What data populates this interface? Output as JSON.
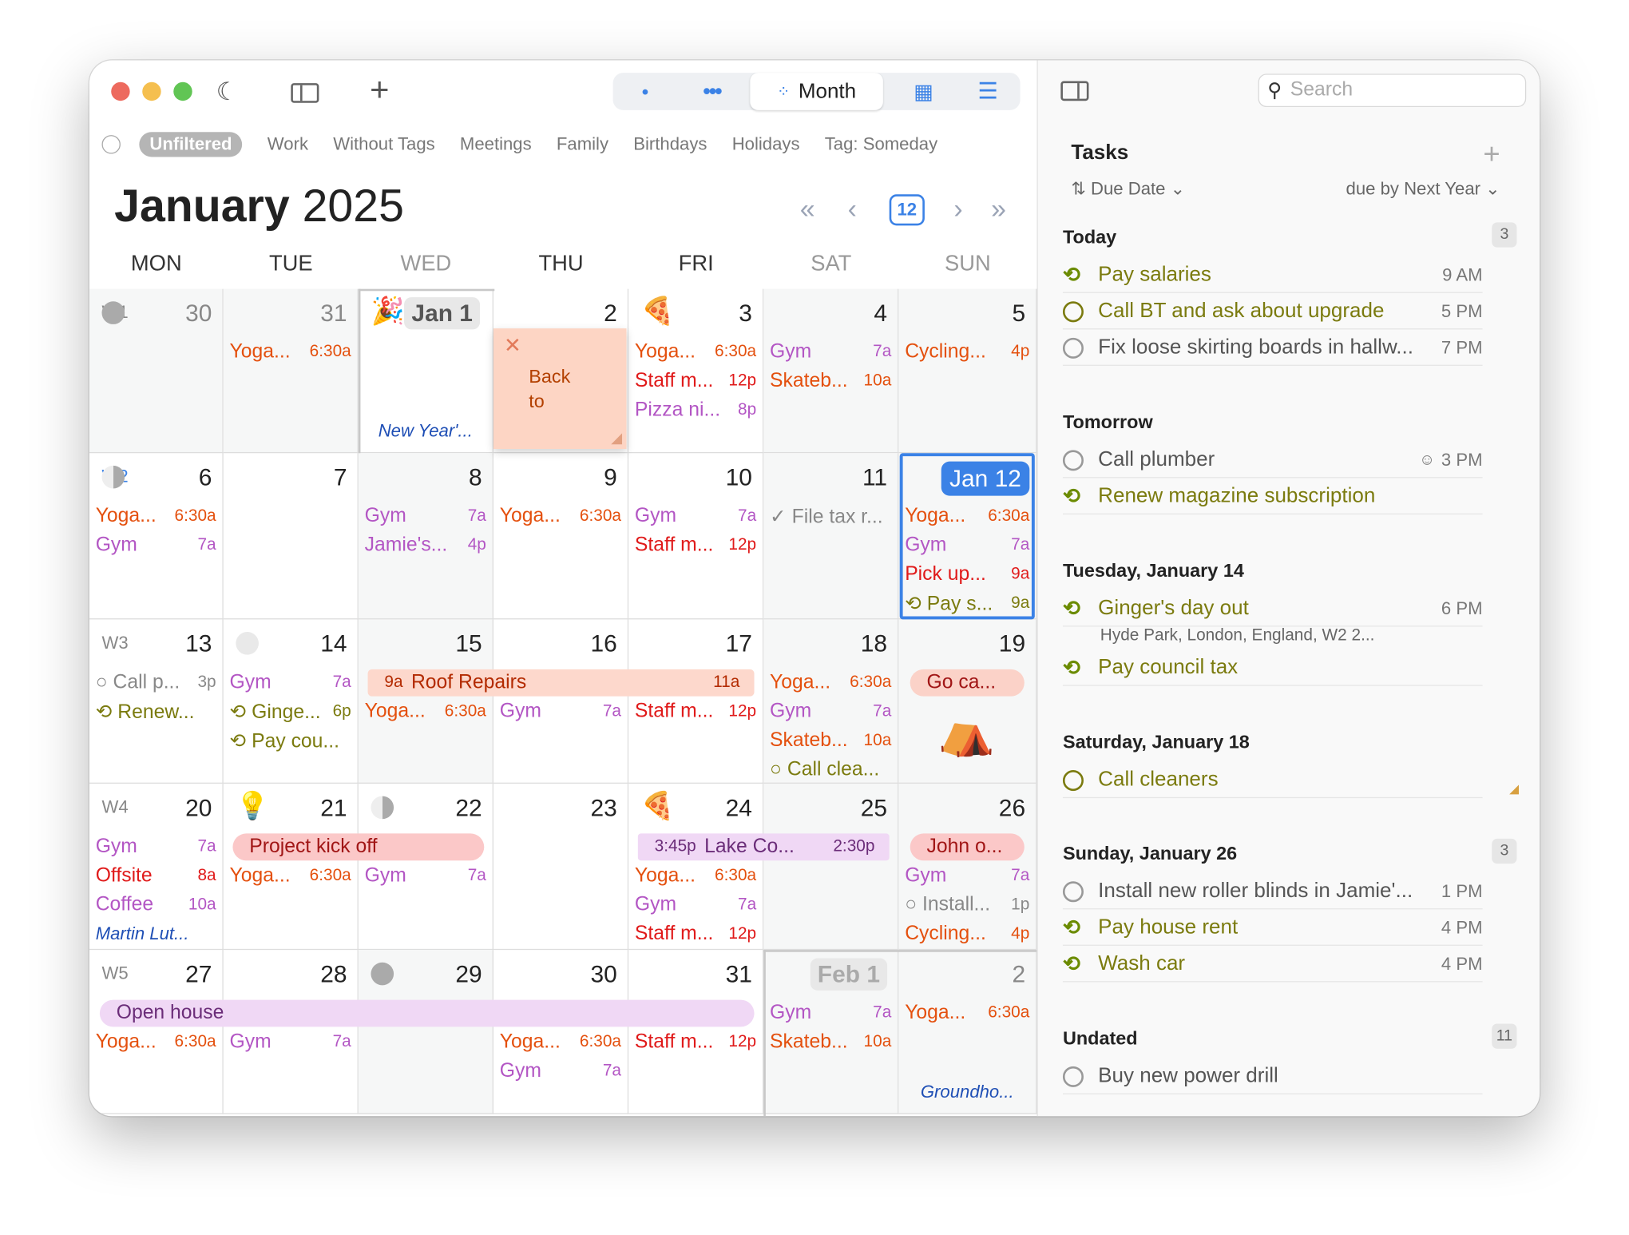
{
  "toolbar": {
    "segment_selected": "Month"
  },
  "filters": [
    "Unfiltered",
    "Work",
    "Without Tags",
    "Meetings",
    "Family",
    "Birthdays",
    "Holidays",
    "Tag: Someday"
  ],
  "calendar": {
    "month": "January",
    "year": "2025",
    "today_button": "12",
    "weekdays": [
      "MON",
      "TUE",
      "WED",
      "THU",
      "FRI",
      "SAT",
      "SUN"
    ],
    "weeks": [
      {
        "label": "W1",
        "days": [
          {
            "num": "30",
            "events": []
          },
          {
            "num": "31",
            "events": [
              {
                "title": "Yoga...",
                "time": "6:30a",
                "c": "o"
              }
            ]
          },
          {
            "num": "Jan 1",
            "events": [
              {
                "title": "New Year'...",
                "time": "",
                "c": "bl",
                "bottom": true
              }
            ]
          },
          {
            "num": "2",
            "events": []
          },
          {
            "num": "3",
            "events": [
              {
                "title": "Yoga...",
                "time": "6:30a",
                "c": "o"
              },
              {
                "title": "Staff m...",
                "time": "12p",
                "c": "r"
              },
              {
                "title": "Pizza ni...",
                "time": "8p",
                "c": "p"
              }
            ]
          },
          {
            "num": "4",
            "events": [
              {
                "title": "Gym",
                "time": "7a",
                "c": "p"
              },
              {
                "title": "Skateb...",
                "time": "10a",
                "c": "o"
              }
            ]
          },
          {
            "num": "5",
            "events": [
              {
                "title": "Cycling...",
                "time": "4p",
                "c": "o"
              }
            ]
          }
        ]
      },
      {
        "label": "W2",
        "days": [
          {
            "num": "6",
            "events": [
              {
                "title": "Yoga...",
                "time": "6:30a",
                "c": "o"
              },
              {
                "title": "Gym",
                "time": "7a",
                "c": "p"
              }
            ]
          },
          {
            "num": "7",
            "events": []
          },
          {
            "num": "8",
            "events": [
              {
                "title": "Gym",
                "time": "7a",
                "c": "p"
              },
              {
                "title": "Jamie's...",
                "time": "4p",
                "c": "p"
              }
            ]
          },
          {
            "num": "9",
            "events": [
              {
                "title": "Yoga...",
                "time": "6:30a",
                "c": "o"
              }
            ]
          },
          {
            "num": "10",
            "events": [
              {
                "title": "Gym",
                "time": "7a",
                "c": "p"
              },
              {
                "title": "Staff m...",
                "time": "12p",
                "c": "r"
              }
            ]
          },
          {
            "num": "11",
            "events": [
              {
                "title": "✓ File tax r...",
                "time": "",
                "c": "gr"
              }
            ]
          },
          {
            "num": "Jan 12",
            "events": [
              {
                "title": "Yoga...",
                "time": "6:30a",
                "c": "o"
              },
              {
                "title": "Gym",
                "time": "7a",
                "c": "p"
              },
              {
                "title": "Pick up...",
                "time": "9a",
                "c": "r"
              },
              {
                "title": "⟲ Pay s...",
                "time": "9a",
                "c": "g"
              }
            ]
          }
        ]
      },
      {
        "label": "W3",
        "days": [
          {
            "num": "13",
            "events": [
              {
                "title": "○ Call p...",
                "time": "3p",
                "c": "gr"
              },
              {
                "title": "⟲ Renew...",
                "time": "",
                "c": "g"
              }
            ]
          },
          {
            "num": "14",
            "events": [
              {
                "title": "Gym",
                "time": "7a",
                "c": "p"
              },
              {
                "title": "⟲ Ginge...",
                "time": "6p",
                "c": "g"
              },
              {
                "title": "⟲ Pay cou...",
                "time": "",
                "c": "g"
              }
            ]
          },
          {
            "num": "15",
            "events": [
              {
                "title": "",
                "time": "",
                "c": "o"
              },
              {
                "title": "Yoga...",
                "time": "6:30a",
                "c": "o"
              }
            ]
          },
          {
            "num": "16",
            "events": [
              {
                "title": "",
                "time": "",
                "c": "o"
              },
              {
                "title": "Gym",
                "time": "7a",
                "c": "p"
              }
            ]
          },
          {
            "num": "17",
            "events": [
              {
                "title": "",
                "time": "",
                "c": "o"
              },
              {
                "title": "Staff m...",
                "time": "12p",
                "c": "r"
              }
            ]
          },
          {
            "num": "18",
            "events": [
              {
                "title": "Yoga...",
                "time": "6:30a",
                "c": "o"
              },
              {
                "title": "Gym",
                "time": "7a",
                "c": "p"
              },
              {
                "title": "Skateb...",
                "time": "10a",
                "c": "o"
              },
              {
                "title": "○ Call clea...",
                "time": "",
                "c": "g"
              }
            ]
          },
          {
            "num": "19",
            "events": []
          }
        ]
      },
      {
        "label": "W4",
        "days": [
          {
            "num": "20",
            "events": [
              {
                "title": "Gym",
                "time": "7a",
                "c": "p"
              },
              {
                "title": "Offsite",
                "time": "8a",
                "c": "r"
              },
              {
                "title": "Coffee",
                "time": "10a",
                "c": "p"
              },
              {
                "title": "Martin Lut...",
                "time": "",
                "c": "bl"
              }
            ]
          },
          {
            "num": "21",
            "events": [
              {
                "title": "",
                "time": "",
                "c": "o"
              },
              {
                "title": "Yoga...",
                "time": "6:30a",
                "c": "o"
              }
            ]
          },
          {
            "num": "22",
            "events": [
              {
                "title": "",
                "time": "",
                "c": "o"
              },
              {
                "title": "Gym",
                "time": "7a",
                "c": "p"
              }
            ]
          },
          {
            "num": "23",
            "events": []
          },
          {
            "num": "24",
            "events": [
              {
                "title": "",
                "time": "",
                "c": "o"
              },
              {
                "title": "Yoga...",
                "time": "6:30a",
                "c": "o"
              },
              {
                "title": "Gym",
                "time": "7a",
                "c": "p"
              },
              {
                "title": "Staff m...",
                "time": "12p",
                "c": "r"
              }
            ]
          },
          {
            "num": "25",
            "events": []
          },
          {
            "num": "26",
            "events": [
              {
                "title": "",
                "time": "",
                "c": "o"
              },
              {
                "title": "Gym",
                "time": "7a",
                "c": "p"
              },
              {
                "title": "○ Install...",
                "time": "1p",
                "c": "gr"
              },
              {
                "title": "Cycling...",
                "time": "4p",
                "c": "o"
              }
            ]
          }
        ]
      },
      {
        "label": "W5",
        "days": [
          {
            "num": "27",
            "events": [
              {
                "title": "",
                "time": "",
                "c": "o"
              },
              {
                "title": "Yoga...",
                "time": "6:30a",
                "c": "o"
              }
            ]
          },
          {
            "num": "28",
            "events": [
              {
                "title": "",
                "time": "",
                "c": "o"
              },
              {
                "title": "Gym",
                "time": "7a",
                "c": "p"
              }
            ]
          },
          {
            "num": "29",
            "events": []
          },
          {
            "num": "30",
            "events": [
              {
                "title": "",
                "time": "",
                "c": "o"
              },
              {
                "title": "Yoga...",
                "time": "6:30a",
                "c": "o"
              },
              {
                "title": "Gym",
                "time": "7a",
                "c": "p"
              }
            ]
          },
          {
            "num": "31",
            "events": [
              {
                "title": "",
                "time": "",
                "c": "o"
              },
              {
                "title": "Staff m...",
                "time": "12p",
                "c": "r"
              }
            ]
          },
          {
            "num": "Feb 1",
            "events": [
              {
                "title": "Gym",
                "time": "7a",
                "c": "p"
              },
              {
                "title": "Skateb...",
                "time": "10a",
                "c": "o"
              }
            ]
          },
          {
            "num": "2",
            "events": [
              {
                "title": "Yoga...",
                "time": "6:30a",
                "c": "o"
              },
              {
                "title": "Groundho...",
                "time": "",
                "c": "bl",
                "bottom": true
              }
            ]
          }
        ]
      }
    ],
    "bars": {
      "roof": {
        "start": "9a",
        "title": "Roof Repairs",
        "end": "11a"
      },
      "lake": {
        "start": "3:45p",
        "title": "Lake Co...",
        "end": "2:30p"
      },
      "kickoff": "Project kick off",
      "open_house": "Open house",
      "go_camping": "Go ca...",
      "john": "John o..."
    },
    "sticky": {
      "text1": "Back",
      "text2": "to"
    }
  },
  "sidebar": {
    "search_placeholder": "Search",
    "title": "Tasks",
    "sort": "Due Date",
    "range": "due by Next Year",
    "sections": {
      "today": {
        "label": "Today",
        "count": "3"
      },
      "tomorrow": {
        "label": "Tomorrow"
      },
      "tue": {
        "label": "Tuesday, January 14"
      },
      "sat": {
        "label": "Saturday, January 18"
      },
      "sun": {
        "label": "Sunday, January 26",
        "count": "3"
      },
      "undated": {
        "label": "Undated",
        "count": "11"
      }
    },
    "tasks": {
      "t1": {
        "title": "Pay salaries",
        "time": "9 AM"
      },
      "t2": {
        "title": "Call BT and ask about upgrade",
        "time": "5 PM"
      },
      "t3": {
        "title": "Fix loose skirting boards in hallw...",
        "time": "7 PM"
      },
      "t4": {
        "title": "Call plumber",
        "time": "3 PM"
      },
      "t5": {
        "title": "Renew magazine subscription",
        "time": ""
      },
      "t6": {
        "title": "Ginger's day out",
        "time": "6 PM",
        "sub": "Hyde Park, London, England, W2 2..."
      },
      "t7": {
        "title": "Pay council tax",
        "time": ""
      },
      "t8": {
        "title": "Call cleaners",
        "time": ""
      },
      "t9": {
        "title": "Install new roller blinds in Jamie'...",
        "time": "1 PM"
      },
      "t10": {
        "title": "Pay house rent",
        "time": "4 PM"
      },
      "t11": {
        "title": "Wash car",
        "time": "4 PM"
      },
      "t12": {
        "title": "Buy new power drill",
        "time": ""
      }
    }
  }
}
